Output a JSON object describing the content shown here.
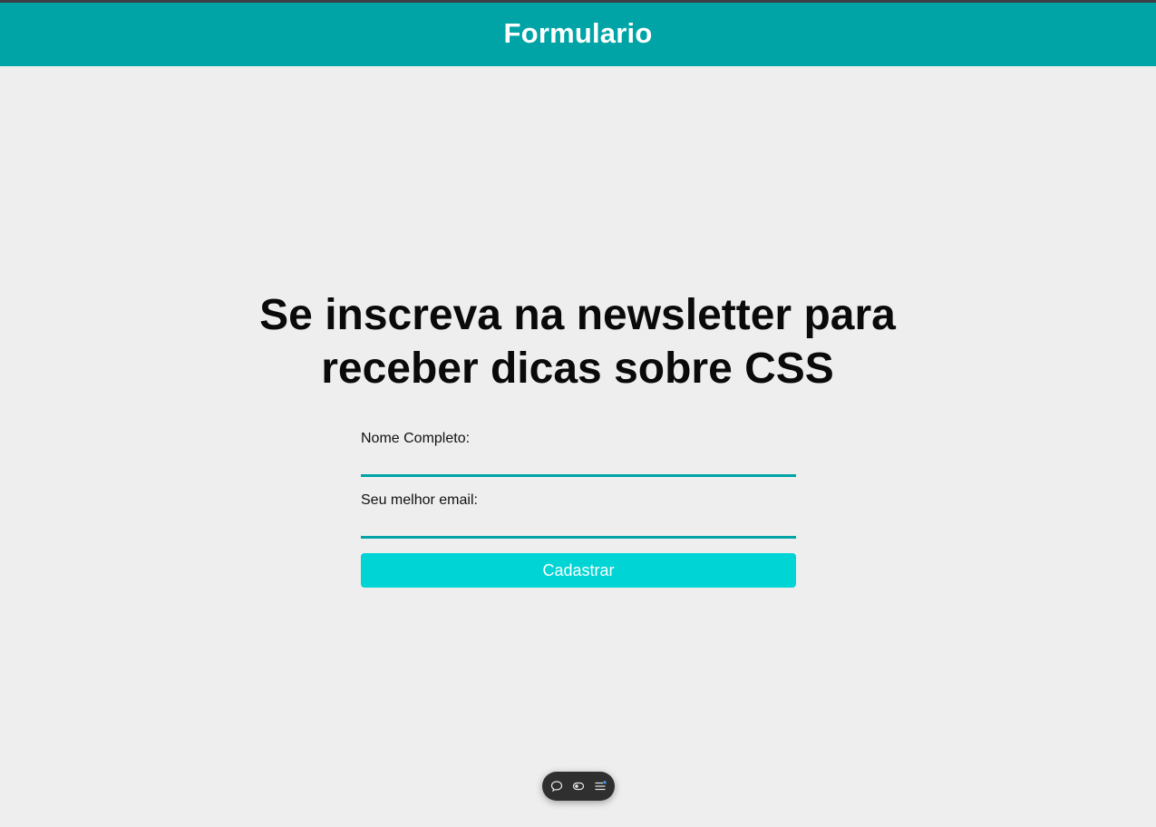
{
  "header": {
    "title": "Formulario"
  },
  "main": {
    "headline": "Se inscreva na newsletter para receber dicas sobre CSS"
  },
  "form": {
    "fields": [
      {
        "label": "Nome Completo:",
        "value": "",
        "placeholder": ""
      },
      {
        "label": "Seu melhor email:",
        "value": "",
        "placeholder": ""
      }
    ],
    "submit_label": "Cadastrar"
  },
  "toolbar": {
    "icons": [
      "comment-icon",
      "toggle-icon",
      "menu-icon"
    ]
  },
  "colors": {
    "header_bg": "#00a4a6",
    "page_bg": "#eeeeee",
    "input_underline": "#00a4a6",
    "button_bg": "#00d4d4",
    "button_text": "#ffffff",
    "toolbar_bg": "#2f2f2f"
  }
}
